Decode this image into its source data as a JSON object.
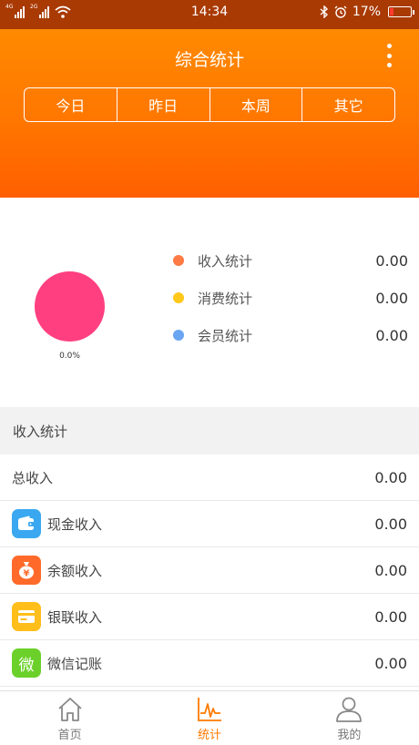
{
  "status_bar": {
    "time": "14:34",
    "battery": "17%",
    "battery_level": 0.17,
    "signal1_tag": "4G",
    "signal2_tag": "2G"
  },
  "header": {
    "title": "综合统计"
  },
  "tabs": [
    {
      "label": "今日"
    },
    {
      "label": "昨日"
    },
    {
      "label": "本周"
    },
    {
      "label": "其它"
    }
  ],
  "summary": {
    "pie_label": "0.0%",
    "pie_color": "#ff3f80",
    "legend": [
      {
        "label": "收入统计",
        "value": "0.00",
        "color": "#ff7a45"
      },
      {
        "label": "消费统计",
        "value": "0.00",
        "color": "#ffc81a"
      },
      {
        "label": "会员统计",
        "value": "0.00",
        "color": "#6aa5f2"
      }
    ]
  },
  "section": {
    "title": "收入统计"
  },
  "income": {
    "total": {
      "label": "总收入",
      "value": "0.00"
    },
    "items": [
      {
        "label": "现金收入",
        "value": "0.00",
        "icon": "wallet-icon",
        "color": "#3aa8f0"
      },
      {
        "label": "余额收入",
        "value": "0.00",
        "icon": "money-bag-icon",
        "color": "#ff6a2a"
      },
      {
        "label": "银联收入",
        "value": "0.00",
        "icon": "card-icon",
        "color": "#ffbe1a"
      },
      {
        "label": "微信记账",
        "value": "0.00",
        "icon": "wechat-icon",
        "color": "#6bd12a",
        "glyph": "微"
      }
    ]
  },
  "nav": [
    {
      "label": "首页",
      "icon": "home-icon"
    },
    {
      "label": "统计",
      "icon": "chart-icon"
    },
    {
      "label": "我的",
      "icon": "user-icon"
    }
  ],
  "accent": "#ff7a00"
}
